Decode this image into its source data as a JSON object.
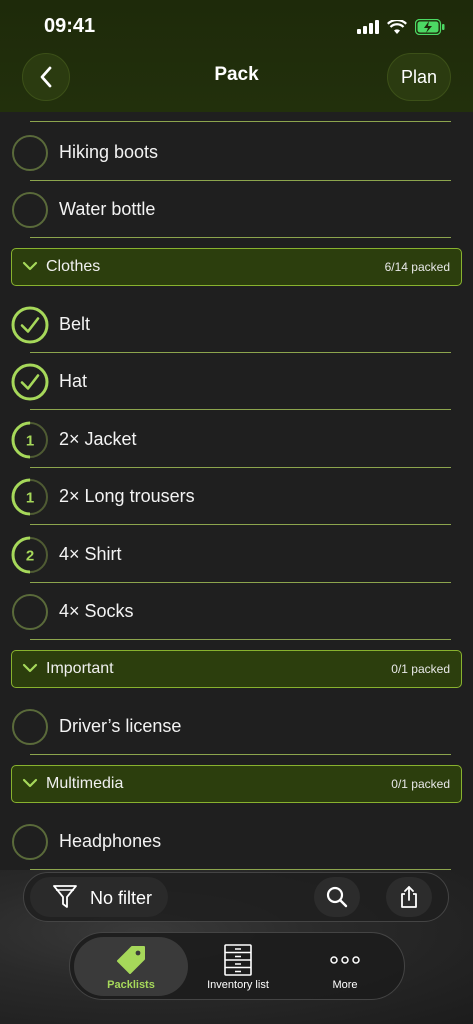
{
  "status": {
    "time": "09:41"
  },
  "nav": {
    "title": "Pack",
    "plan_label": "Plan"
  },
  "colors": {
    "accent": "#a6d85a",
    "section_bg": "#2c3e0d",
    "section_border": "#88b22e"
  },
  "list": {
    "rows": [
      {
        "label": "Hiking boots",
        "state": "empty"
      },
      {
        "label": "Water bottle",
        "state": "empty"
      },
      {
        "label": "Belt",
        "state": "checked"
      },
      {
        "label": "Hat",
        "state": "checked"
      },
      {
        "label": "2× Jacket",
        "state": "partial",
        "count": "1",
        "progress": 0.5
      },
      {
        "label": "2× Long trousers",
        "state": "partial",
        "count": "1",
        "progress": 0.5
      },
      {
        "label": "4× Shirt",
        "state": "partial",
        "count": "2",
        "progress": 0.5
      },
      {
        "label": "4× Socks",
        "state": "empty"
      },
      {
        "label": "Driver’s license",
        "state": "empty"
      },
      {
        "label": "Headphones",
        "state": "empty"
      }
    ],
    "sections": [
      {
        "title": "Clothes",
        "count": "6/14 packed"
      },
      {
        "title": "Important",
        "count": "0/1 packed"
      },
      {
        "title": "Multimedia",
        "count": "0/1 packed"
      }
    ]
  },
  "filter": {
    "label": "No filter",
    "icon": "funnel-icon"
  },
  "tabs": [
    {
      "label": "Packlists",
      "icon": "tag-icon",
      "active": true
    },
    {
      "label": "Inventory list",
      "icon": "drawers-icon",
      "active": false
    },
    {
      "label": "More",
      "icon": "ellipsis-icon",
      "active": false
    }
  ]
}
